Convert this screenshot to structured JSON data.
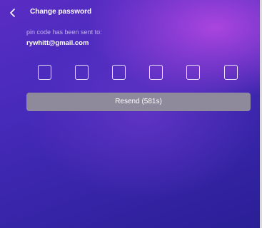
{
  "header": {
    "title": "Change password",
    "back_icon": "chevron-left-icon"
  },
  "message": {
    "sent_to_label": "pin code has been sent to:",
    "email": "rywhitt@gmail.com"
  },
  "pin": {
    "length": 6,
    "digits": [
      "",
      "",
      "",
      "",
      "",
      ""
    ]
  },
  "resend": {
    "label": "Resend (581s)"
  },
  "colors": {
    "background_top": "#5a2cc4",
    "background_bottom": "#2a1f96",
    "accent_glow": "#af46e1",
    "resend_button": "#8e8a9c",
    "text": "#ffffff"
  }
}
